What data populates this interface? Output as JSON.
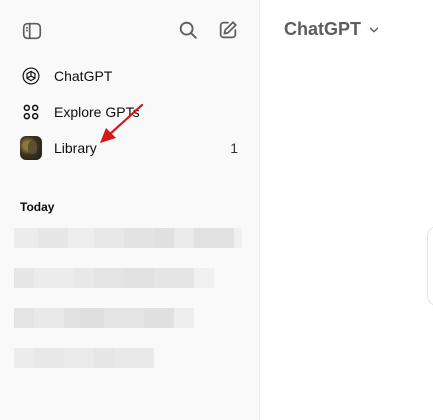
{
  "sidebar": {
    "toggle_icon": "sidebar-toggle-icon",
    "search_icon": "search-icon",
    "new_chat_icon": "new-chat-icon",
    "items": [
      {
        "label": "ChatGPT",
        "icon": "openai-logo-icon"
      },
      {
        "label": "Explore GPTs",
        "icon": "grid-icon"
      },
      {
        "label": "Library",
        "icon": "library-thumbnail",
        "count": "1"
      }
    ],
    "section_heading": "Today"
  },
  "header": {
    "model_selector_label": "ChatGPT",
    "chevron_icon": "chevron-down-icon"
  },
  "annotation": {
    "arrow_color": "#d11a1a",
    "points_to": "Library"
  },
  "colors": {
    "sidebar_bg": "#f9f9f9",
    "main_bg": "#ffffff",
    "title_text": "#5d5d5d"
  }
}
